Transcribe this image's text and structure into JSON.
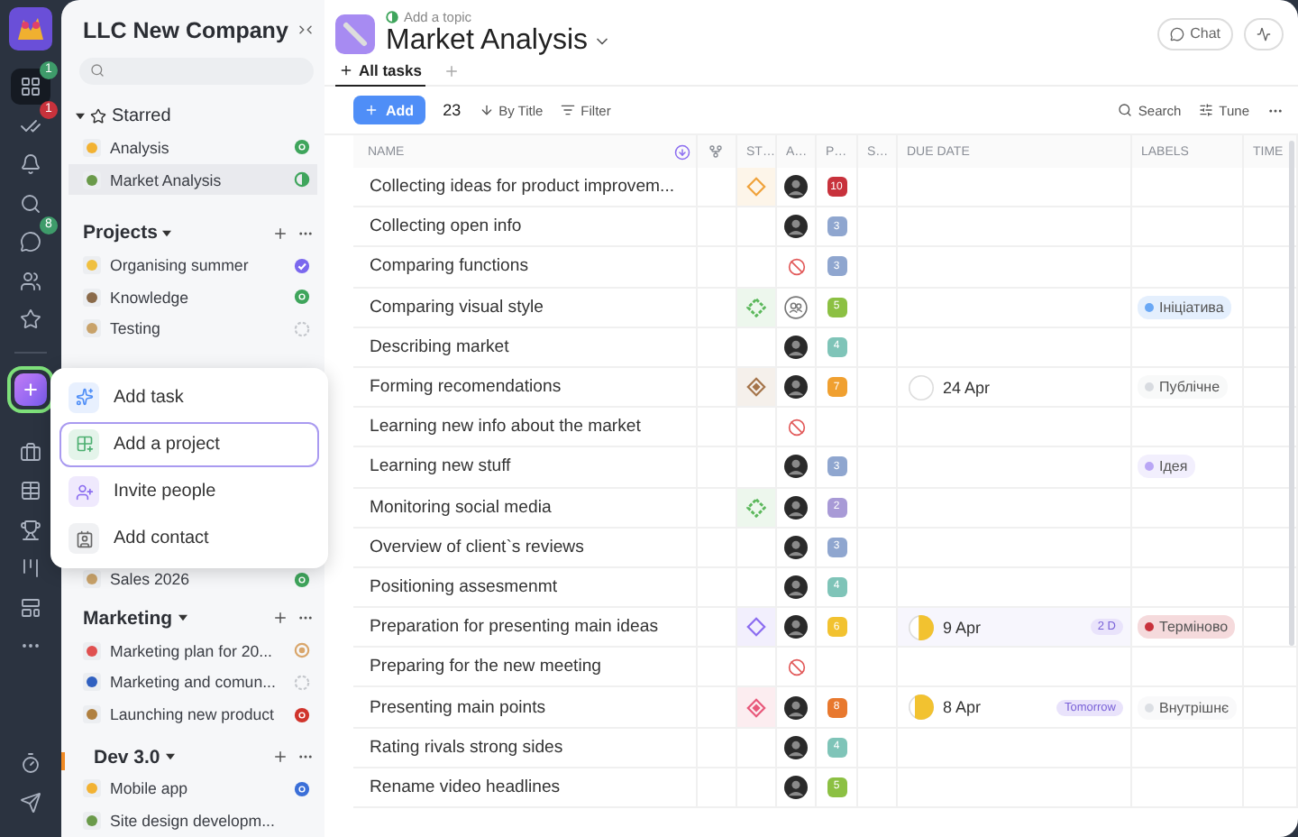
{
  "rail": {
    "top_items": [
      {
        "kind": "grid",
        "selected": true,
        "badge": {
          "text": "1",
          "color": "#3e9b6a"
        }
      },
      {
        "kind": "tasks",
        "selected": false,
        "badge": {
          "text": "1",
          "color": "#c8323c"
        }
      },
      {
        "kind": "bell",
        "selected": false
      },
      {
        "kind": "search",
        "selected": false
      },
      {
        "kind": "chat",
        "selected": false,
        "badge": {
          "text": "8",
          "color": "#3e9b6a"
        }
      },
      {
        "kind": "people",
        "selected": false
      },
      {
        "kind": "star",
        "selected": false
      }
    ],
    "add_button": {
      "expanded": true
    },
    "tool_items": [
      {
        "kind": "briefcase",
        "selected": false
      },
      {
        "kind": "table",
        "selected": false
      },
      {
        "kind": "trophy",
        "selected": false
      },
      {
        "kind": "board",
        "selected": false
      },
      {
        "kind": "cards",
        "selected": false
      },
      {
        "kind": "more",
        "selected": false
      }
    ],
    "bottom_items": [
      {
        "kind": "timer",
        "selected": false
      },
      {
        "kind": "send",
        "selected": false
      }
    ]
  },
  "sidebar": {
    "title": "LLC New Company",
    "sections": [
      {
        "title": "Starred",
        "kind": "starred",
        "expanded": true,
        "items": [
          {
            "name": "Analysis",
            "kind": "full",
            "color": "#3fa55c",
            "selected": false
          },
          {
            "name": "Market Analysis",
            "kind": "half",
            "color": "#3fa55c",
            "selected": true
          }
        ]
      },
      {
        "title": "Projects",
        "kind": "group",
        "expanded": true,
        "items": [
          {
            "name": "Organising summer",
            "kind": "check",
            "color": "#7b68ee",
            "selected": false
          },
          {
            "name": "Knowledge",
            "kind": "full",
            "color": "#3fa55c",
            "selected": false
          },
          {
            "name": "Testing",
            "kind": "empty",
            "color": "#c4c7cc",
            "selected": false
          }
        ],
        "items_below_menu": [
          {
            "name": "Sales 2026",
            "kind": "full",
            "color": "#3fa55c",
            "selected": false
          }
        ]
      },
      {
        "title": "Marketing",
        "kind": "group",
        "expanded": true,
        "items": [
          {
            "name": "Marketing plan for 20...",
            "kind": "ring",
            "color": "#d9a66b",
            "selected": false
          },
          {
            "name": "Marketing and comun...",
            "kind": "empty",
            "color": "#c4c7cc",
            "selected": false
          },
          {
            "name": "Launching new product",
            "kind": "full",
            "color": "#d0342c",
            "selected": false
          }
        ]
      },
      {
        "title": "Dev 3.0",
        "kind": "team",
        "expanded": true,
        "items": [
          {
            "name": "Mobile app",
            "kind": "full",
            "color": "#3b6fd8",
            "selected": false
          },
          {
            "name": "Site design developm...",
            "kind": "none",
            "selected": false
          }
        ]
      }
    ]
  },
  "quick_menu": {
    "items": [
      {
        "label": "Add task",
        "kind": "task",
        "selected": false
      },
      {
        "label": "Add a project",
        "kind": "project",
        "selected": true
      },
      {
        "label": "Invite people",
        "kind": "invite",
        "selected": false
      },
      {
        "label": "Add contact",
        "kind": "contact",
        "selected": false
      }
    ]
  },
  "header": {
    "topic": "Add a topic",
    "title": "Market Analysis",
    "chat_button": "Chat"
  },
  "tabs": [
    {
      "label": "All tasks",
      "selected": true
    }
  ],
  "toolbar": {
    "add_button": "Add",
    "count": "23",
    "sort": "By Title",
    "filter": "Filter",
    "search": "Search",
    "tune": "Tune"
  },
  "table": {
    "columns": [
      {
        "kind": "name",
        "label": "NAME"
      },
      {
        "kind": "icon"
      },
      {
        "kind": "text",
        "label": "ST…"
      },
      {
        "kind": "text",
        "label": "A…"
      },
      {
        "kind": "text",
        "label": "P…"
      },
      {
        "kind": "text",
        "label": "S…"
      },
      {
        "kind": "text",
        "label": "DUE DATE"
      },
      {
        "kind": "text",
        "label": "LABELS"
      },
      {
        "kind": "text",
        "label": "TIME"
      }
    ],
    "rows": [
      {
        "name": "Collecting ideas for product improvem...",
        "status": {
          "kind": "outline",
          "color": "#f0a23a"
        },
        "assignee": {
          "kind": "person"
        },
        "priority": {
          "text": "10",
          "color": "#c8323c"
        }
      },
      {
        "name": "Collecting open info",
        "assignee": {
          "kind": "person"
        },
        "priority": {
          "text": "3",
          "color": "#8fa6cf"
        }
      },
      {
        "name": "Comparing functions",
        "assignee": {
          "kind": "unassigned"
        },
        "priority": {
          "text": "3",
          "color": "#8fa6cf"
        }
      },
      {
        "name": "Comparing visual style",
        "status": {
          "kind": "dotted",
          "color": "#5cb85c"
        },
        "assignee": {
          "kind": "group"
        },
        "priority": {
          "text": "5",
          "color": "#8cc043"
        },
        "label": {
          "text": "Ініціатива",
          "color": "#6aa8f5"
        }
      },
      {
        "name": "Describing market",
        "assignee": {
          "kind": "person"
        },
        "priority": {
          "text": "4",
          "color": "#7fc4b8"
        }
      },
      {
        "name": "Forming recomendations",
        "status": {
          "kind": "filled",
          "color": "#a5744a"
        },
        "assignee": {
          "kind": "person"
        },
        "priority": {
          "text": "7",
          "color": "#f0a030"
        },
        "due": {
          "date": "24 Apr"
        },
        "label": {
          "text": "Публічне",
          "color": "#d8dbe0"
        }
      },
      {
        "name": "Learning new info about the market",
        "assignee": {
          "kind": "unassigned"
        }
      },
      {
        "name": "Learning new stuff",
        "assignee": {
          "kind": "person"
        },
        "priority": {
          "text": "3",
          "color": "#8fa6cf"
        },
        "label": {
          "text": "Ідея",
          "color": "#b9a6f5"
        }
      },
      {
        "name": "Monitoring social media",
        "status": {
          "kind": "dotted",
          "color": "#5cb85c"
        },
        "assignee": {
          "kind": "person"
        },
        "priority": {
          "text": "2",
          "color": "#a89ad6"
        }
      },
      {
        "name": "Overview of client`s reviews",
        "assignee": {
          "kind": "person"
        },
        "priority": {
          "text": "3",
          "color": "#8fa6cf"
        }
      },
      {
        "name": "Positioning assesmenmt",
        "assignee": {
          "kind": "person"
        },
        "priority": {
          "text": "4",
          "color": "#7fc4b8"
        }
      },
      {
        "name": "Preparation for presenting main ideas",
        "status": {
          "kind": "outline",
          "color": "#8b6cf0"
        },
        "assignee": {
          "kind": "person"
        },
        "priority": {
          "text": "6",
          "color": "#f2c230"
        },
        "due": {
          "date": "9 Apr",
          "level": 0.6,
          "badge": "2 D"
        },
        "label": {
          "text": "Терміново",
          "color": "#c8323c"
        }
      },
      {
        "name": "Preparing for the new meeting",
        "assignee": {
          "kind": "unassigned"
        }
      },
      {
        "name": "Presenting main points",
        "status": {
          "kind": "filled",
          "color": "#e8587a"
        },
        "assignee": {
          "kind": "person"
        },
        "priority": {
          "text": "8",
          "color": "#e8782e"
        },
        "due": {
          "date": "8 Apr",
          "level": 0.75,
          "badge": "Tomorrow"
        },
        "label": {
          "text": "Внутрішнє",
          "color": "#dcdfe4"
        }
      },
      {
        "name": "Rating rivals strong sides",
        "assignee": {
          "kind": "person"
        },
        "priority": {
          "text": "4",
          "color": "#7fc4b8"
        }
      },
      {
        "name": "Rename video headlines",
        "assignee": {
          "kind": "person"
        },
        "priority": {
          "text": "5",
          "color": "#8cc043"
        }
      }
    ]
  }
}
